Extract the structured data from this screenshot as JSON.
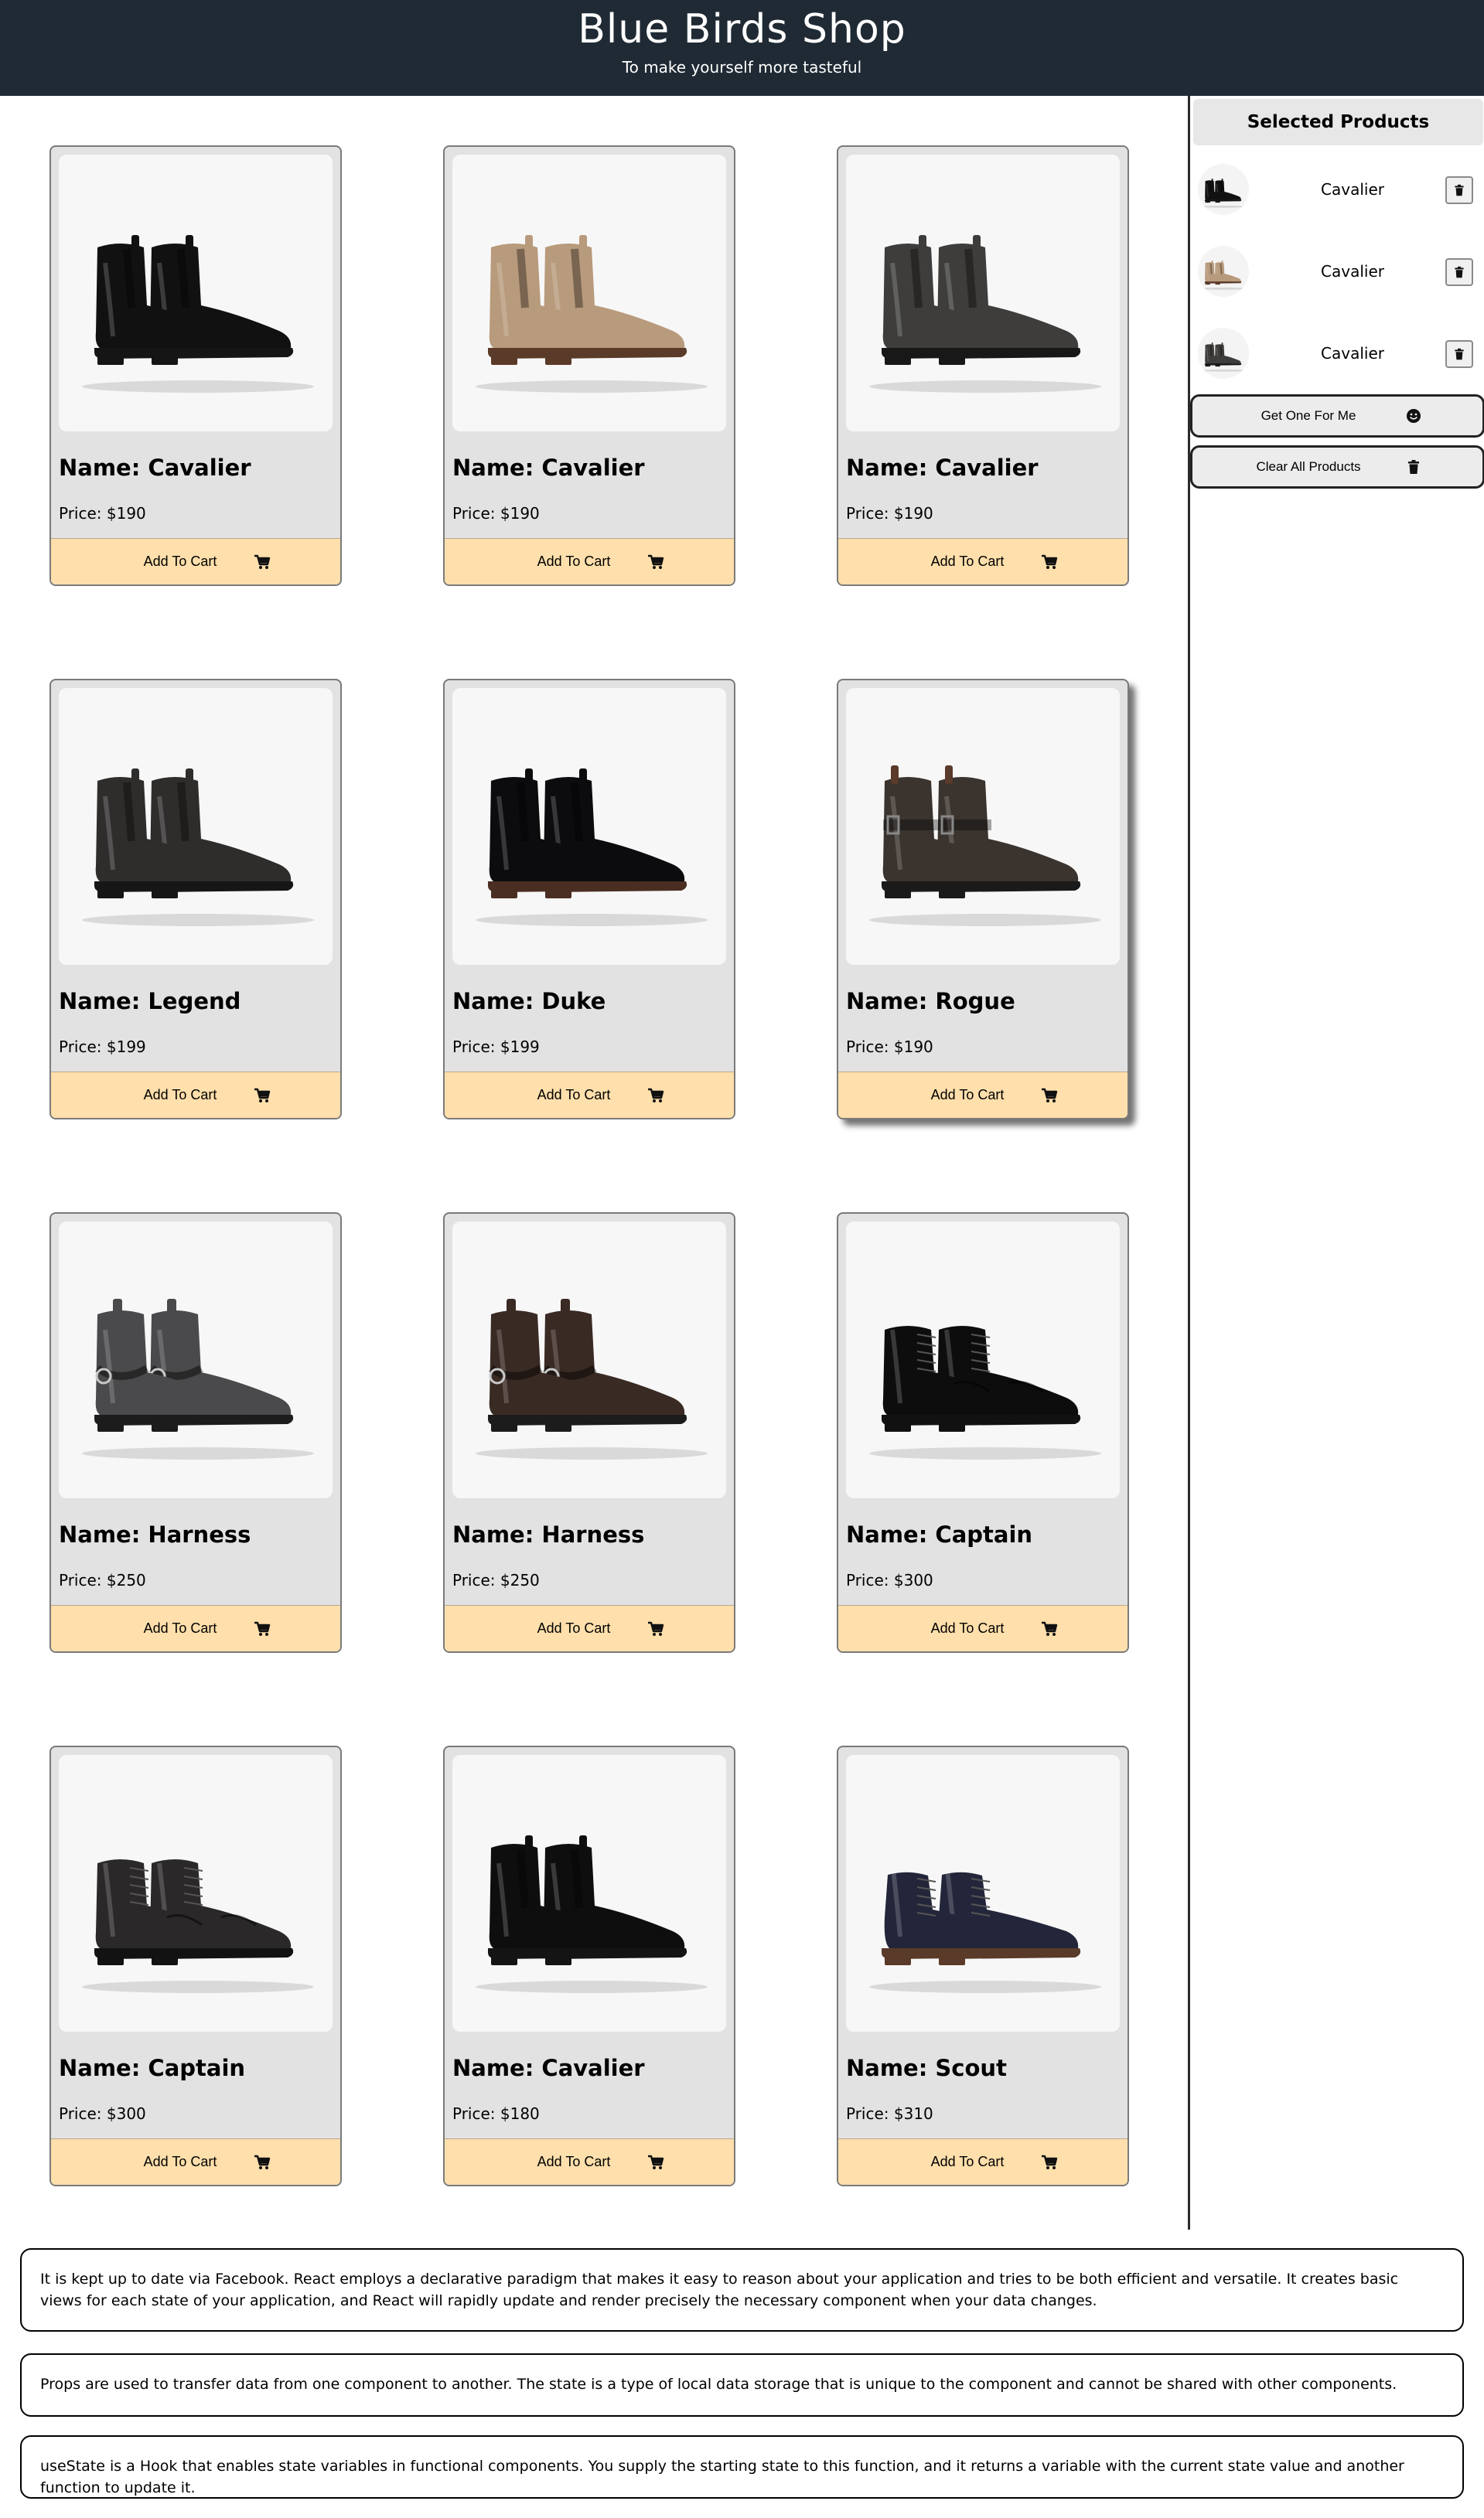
{
  "header": {
    "title": "Blue Birds Shop",
    "subtitle": "To make yourself more tasteful"
  },
  "products": [
    {
      "name": "Name: Cavalier",
      "price": "Price: $190",
      "button": "Add To Cart",
      "style": "chelsea",
      "color": "#111111",
      "sole": "#151515"
    },
    {
      "name": "Name: Cavalier",
      "price": "Price: $190",
      "button": "Add To Cart",
      "style": "chelsea",
      "color": "#b89a7c",
      "sole": "#5a3a28"
    },
    {
      "name": "Name: Cavalier",
      "price": "Price: $190",
      "button": "Add To Cart",
      "style": "chelsea",
      "color": "#3e3d3b",
      "sole": "#181818"
    },
    {
      "name": "Name: Legend",
      "price": "Price: $199",
      "button": "Add To Cart",
      "style": "chelsea",
      "color": "#2f2d2c",
      "sole": "#161616"
    },
    {
      "name": "Name: Duke",
      "price": "Price: $199",
      "button": "Add To Cart",
      "style": "chelsea",
      "color": "#0c0c0e",
      "sole": "#4a2e22"
    },
    {
      "name": "Name: Rogue",
      "price": "Price: $190",
      "button": "Add To Cart",
      "style": "strap",
      "color": "#3a332e",
      "sole": "#1a1a1a"
    },
    {
      "name": "Name: Harness",
      "price": "Price: $250",
      "button": "Add To Cart",
      "style": "harness",
      "color": "#4a4a4c",
      "sole": "#1c1c1c"
    },
    {
      "name": "Name: Harness",
      "price": "Price: $250",
      "button": "Add To Cart",
      "style": "harness",
      "color": "#3a2a24",
      "sole": "#1c1c1c"
    },
    {
      "name": "Name: Captain",
      "price": "Price: $300",
      "button": "Add To Cart",
      "style": "lace",
      "color": "#0d0d0d",
      "sole": "#111111"
    },
    {
      "name": "Name: Captain",
      "price": "Price: $300",
      "button": "Add To Cart",
      "style": "lace",
      "color": "#2a2828",
      "sole": "#121212"
    },
    {
      "name": "Name: Cavalier",
      "price": "Price: $180",
      "button": "Add To Cart",
      "style": "chelsea",
      "color": "#0e0e0e",
      "sole": "#141414"
    },
    {
      "name": "Name: Scout",
      "price": "Price: $310",
      "button": "Add To Cart",
      "style": "chukka",
      "color": "#23263a",
      "sole": "#5a3a28"
    }
  ],
  "sidebar": {
    "title": "Selected Products",
    "items": [
      {
        "label": "Cavalier",
        "color": "#111111",
        "sole": "#151515"
      },
      {
        "label": "Cavalier",
        "color": "#b89a7c",
        "sole": "#5a3a28"
      },
      {
        "label": "Cavalier",
        "color": "#3e3d3b",
        "sole": "#181818"
      }
    ],
    "get_one_label": "Get One For Me",
    "clear_label": "Clear All Products"
  },
  "info": [
    "It is kept up to date via Facebook. React employs a declarative paradigm that makes it easy to reason about your application and tries to be both efficient and versatile. It creates basic views for each state of your application, and React will rapidly update and render precisely the necessary component when your data changes.",
    "Props are used to transfer data from one component to another. The state is a type of local data storage that is unique to the component and cannot be shared with other components.",
    "useState is a Hook that enables state variables in functional components. You supply the starting state to this function, and it returns a variable with the current state value and another function to update it."
  ],
  "colors": {
    "header_bg": "#1f2a34",
    "card_bg": "#e3e2e3",
    "cart_button_bg": "#ffdfab"
  },
  "icons": {
    "cart": "cart-icon",
    "trash": "trash-icon",
    "smile": "smile-icon"
  }
}
